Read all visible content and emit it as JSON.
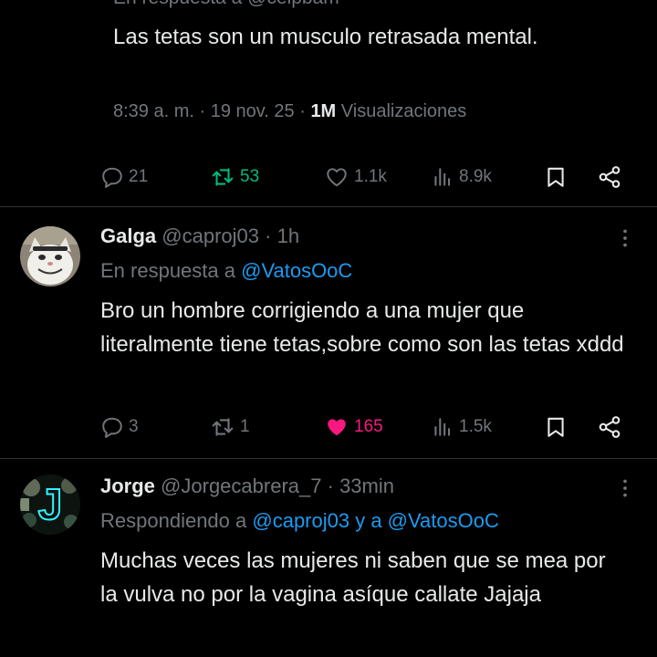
{
  "main_tweet": {
    "replying_partial": "En respuesta a @celpbam",
    "text": "Las tetas son un musculo retrasada mental.",
    "time": "8:39 a. m.",
    "date": "19 nov. 25",
    "views_count": "1M",
    "views_label": "Visualizaciones",
    "stats": {
      "replies": "21",
      "reposts": "53",
      "likes": "1.1k",
      "views": "8.9k"
    }
  },
  "replies": [
    {
      "name": "Galga",
      "handle": "@caproj03",
      "time": "1h",
      "replying_prefix": "En respuesta a",
      "replying_to": "@VatosOoC",
      "text": "Bro un hombre corrigiendo a una mujer que literalmente tiene tetas,sobre como son las tetas xddd",
      "stats": {
        "replies": "3",
        "reposts": "1",
        "likes": "165",
        "views": "1.5k"
      },
      "liked": true
    },
    {
      "name": "Jorge",
      "handle": "@Jorgecabrera_7",
      "time": "33min",
      "replying_prefix": "Respondiendo a",
      "replying_to": "@caproj03 y a @VatosOoC",
      "text": "Muchas veces las mujeres ni saben que se mea por la vulva no por la vagina asíque callate Jajaja",
      "avatar_letter": "J"
    }
  ],
  "colors": {
    "bg": "#000000",
    "text": "#e7e9ea",
    "muted": "#71767b",
    "link": "#1d9bf0",
    "repost": "#00ba7c",
    "like": "#f91880"
  },
  "icons": [
    "reply-icon",
    "repost-icon",
    "like-icon",
    "views-icon",
    "bookmark-icon",
    "share-icon",
    "more-icon"
  ]
}
